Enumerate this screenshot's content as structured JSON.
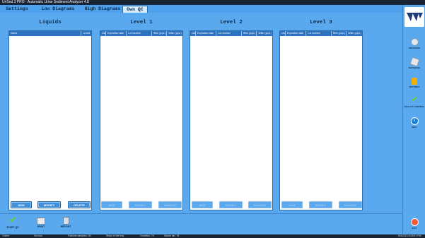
{
  "window": {
    "title": "UriSed 3 PRO - Automatic Urine Sediment Analyzer 4.8"
  },
  "tabs": [
    {
      "label": "Settings"
    },
    {
      "label": "Low Diagrams"
    },
    {
      "label": "High Diagrams"
    },
    {
      "label": "Own QC"
    }
  ],
  "liquids": {
    "title": "Liquids",
    "columns": [
      "Name",
      "Levels"
    ],
    "buttons": {
      "new": "NEW",
      "modify": "MODIFY",
      "delete": "DELETE"
    }
  },
  "levels": [
    {
      "title": "Level 1"
    },
    {
      "title": "Level 2"
    },
    {
      "title": "Level 3"
    }
  ],
  "level_columns": [
    "Use",
    "Expiration date",
    "Lot number",
    "RBC (p/µL)",
    "WBC (p/µL)"
  ],
  "level_buttons": {
    "new": "NEW",
    "modify": "MODIFY",
    "remove": "REMOVE"
  },
  "sidebar": [
    {
      "label": "PROGRAM",
      "icon": "gear-icon"
    },
    {
      "label": "DATABASE",
      "icon": "database-icon"
    },
    {
      "label": "SETTINGS",
      "icon": "wrench-icon"
    },
    {
      "label": "QUALITY CONTROL",
      "icon": "checkmark-icon"
    },
    {
      "label": "INFO",
      "icon": "info-icon"
    }
  ],
  "bottom_buttons": [
    {
      "label": "START QC",
      "icon": "checkmark-icon"
    },
    {
      "label": "PRINT",
      "icon": "printer-icon"
    },
    {
      "label": "REPORT",
      "icon": "report-icon"
    }
  ],
  "exit_label": "EXIT",
  "status": {
    "items": [
      "Online",
      "Service",
      "Patients samples: 45",
      "Strips in the tray",
      "Cuvettes: 79",
      "Waste bin: 78"
    ],
    "datetime": "8/4/2023 8:28:01 PM"
  }
}
